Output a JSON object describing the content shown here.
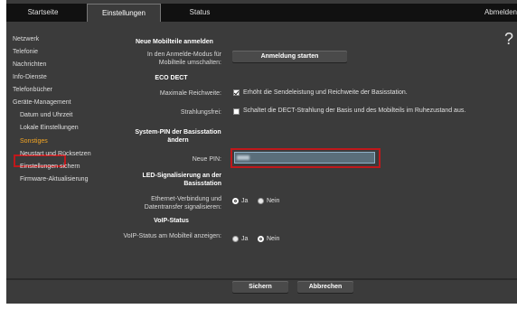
{
  "tabs": [
    "Startseite",
    "Einstellungen",
    "Status"
  ],
  "logout": "Abmelden",
  "help_glyph": "?",
  "sidebar": {
    "items": [
      "Netzwerk",
      "Telefonie",
      "Nachrichten",
      "Info-Dienste",
      "Telefonbücher",
      "Geräte-Management"
    ],
    "subitems": [
      "Datum und Uhrzeit",
      "Lokale Einstellungen",
      "Sonstiges",
      "Neustart und Rücksetzen",
      "Einstellungen sichern",
      "Firmware-Aktualisierung"
    ]
  },
  "main": {
    "register_heading": "Neue Mobilteile anmelden",
    "register_label": "In den Anmelde-Modus für Mobilteile umschalten:",
    "register_button": "Anmeldung starten",
    "eco_heading": "ECO DECT",
    "max_range_label": "Maximale Reichweite:",
    "max_range_text": "Erhöht die Sendeleistung und Reichweite der Basisstation.",
    "max_range_checked": true,
    "radiation_label": "Strahlungsfrei:",
    "radiation_text": "Schaltet die DECT-Strahlung der Basis und des Mobilteils im Ruhezustand aus.",
    "radiation_checked": false,
    "pin_heading": "System-PIN der Basisstation ändern",
    "new_pin_label": "Neue PIN:",
    "new_pin_value": "",
    "led_heading": "LED-Signalisierung an der Basisstation",
    "ethernet_label": "Ethernet-Verbindung und Datentransfer signalisieren:",
    "ethernet_selected": "Ja",
    "voip_heading": "VoIP-Status",
    "voip_label": "VoIP-Status am Mobilteil anzeigen:",
    "voip_selected": "Nein",
    "option_yes": "Ja",
    "option_no": "Nein",
    "save_button": "Sichern",
    "cancel_button": "Abbrechen"
  },
  "colors": {
    "background": "#3b3b3b",
    "topbar": "#111111",
    "active_nav": "#f5a623",
    "highlight_box": "#c0181b"
  }
}
